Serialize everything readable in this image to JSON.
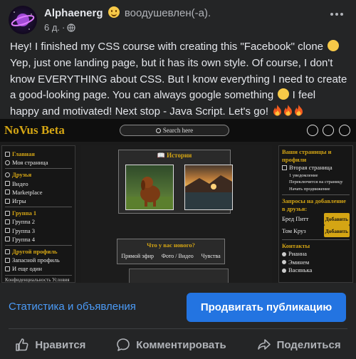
{
  "post": {
    "author": "Alphaenerg",
    "feeling": "воодушевлен(-а).",
    "time": "6 д.",
    "separator": "·",
    "text_part1": "Hey! I finished my CSS course with creating this \"Facebook\" clone",
    "text_part2": " Yep, just one landing page, but it has its own style. Of course, I don't know EVERYTHING about CSS. But I know everything I need to create a good-looking page. You can always google something",
    "text_part3": " I feel happy and motivated! Next stop - Java Script. Let's go!"
  },
  "shot": {
    "logo": "NoVus Beta",
    "search_placeholder": "Search here",
    "sidebar": {
      "home_title": "Главная",
      "home_items": [
        "Моя страница"
      ],
      "friends_title": "Друзья",
      "friends_items": [
        "Видео",
        "Marketplace",
        "Игры"
      ],
      "group_title": "Группа 1",
      "group_items": [
        "Группа 2",
        "Группа 3",
        "Группа 4"
      ],
      "profile_title": "Другой профиль",
      "profile_items": [
        "Запасной профиль",
        "И еще один"
      ],
      "footer": "Конфиденциальность Условия"
    },
    "stories_title": "Истории",
    "whatsnew_title": "Что у вас нового?",
    "whatsnew_options": [
      "Прямой эфир",
      "Фото / Видео",
      "Чувства"
    ],
    "rightbar": {
      "pages_title": "Ваши страницы и профили",
      "second_page": "Вторая страница",
      "sub_items": [
        "1 уведомление",
        "Переключится на страницу",
        "Начать продвижение"
      ],
      "requests_title": "Запросы на добавление в друзья:",
      "requests": [
        {
          "name": "Бред Питт",
          "button": "Добавить"
        },
        {
          "name": "Том Круз",
          "button": "Добавить"
        }
      ],
      "contacts_title": "Контакты",
      "contacts": [
        "Рианна",
        "Эминем",
        "Васянька"
      ]
    }
  },
  "footer": {
    "stats_link": "Статистика и объявления",
    "promote_button": "Продвигать публикацию",
    "like": "Нравится",
    "comment": "Комментировать",
    "share": "Поделиться"
  }
}
